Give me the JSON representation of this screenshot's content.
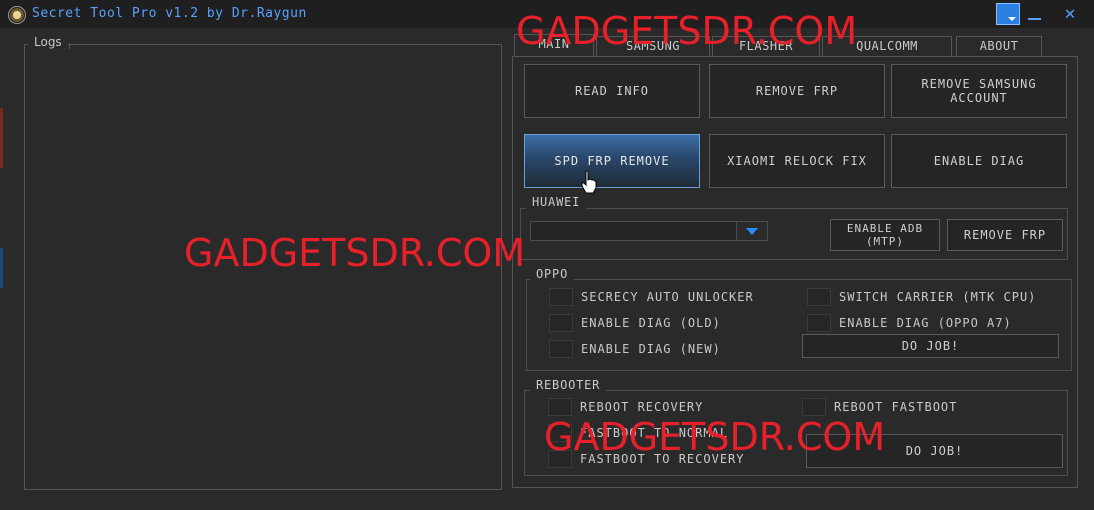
{
  "window": {
    "title": "Secret Tool Pro v1.2 by Dr.Raygun",
    "close_glyph": "✕"
  },
  "logs": {
    "label": "Logs"
  },
  "tabs": [
    {
      "label": "MAIN"
    },
    {
      "label": "SAMSUNG"
    },
    {
      "label": "FLASHER"
    },
    {
      "label": "QUALCOMM"
    },
    {
      "label": "ABOUT"
    }
  ],
  "main_buttons": {
    "read_info": "READ INFO",
    "remove_frp": "REMOVE FRP",
    "remove_samsung_account_1": "REMOVE SAMSUNG",
    "remove_samsung_account_2": "ACCOUNT",
    "spd_frp_remove": "SPD FRP REMOVE",
    "xiaomi_relock_fix": "XIAOMI RELOCK FIX",
    "enable_diag": "ENABLE DIAG"
  },
  "huawei": {
    "label": "HUAWEI",
    "combo_value": "",
    "enable_adb_1": "ENABLE ADB",
    "enable_adb_2": "(MTP)",
    "remove_frp": "REMOVE FRP"
  },
  "oppo": {
    "label": "OPPO",
    "options": [
      "SECRECY AUTO UNLOCKER",
      "ENABLE DIAG (OLD)",
      "ENABLE DIAG (NEW)",
      "SWITCH CARRIER (MTK CPU)",
      "ENABLE DIAG (OPPO A7)"
    ],
    "do_job": "DO JOB!"
  },
  "rebooter": {
    "label": "REBOOTER",
    "options": [
      "REBOOT RECOVERY",
      "FASTBOOT TO NORMAL",
      "FASTBOOT TO RECOVERY",
      "REBOOT FASTBOOT"
    ],
    "do_job": "DO JOB!"
  },
  "watermarks": [
    "GADGETSDR.COM",
    "GADGETSDR.COM",
    "GADGETSDR.COM"
  ],
  "colors": {
    "accent": "#2b8cff",
    "watermark": "#e8202a",
    "background": "#2a2a2a"
  }
}
